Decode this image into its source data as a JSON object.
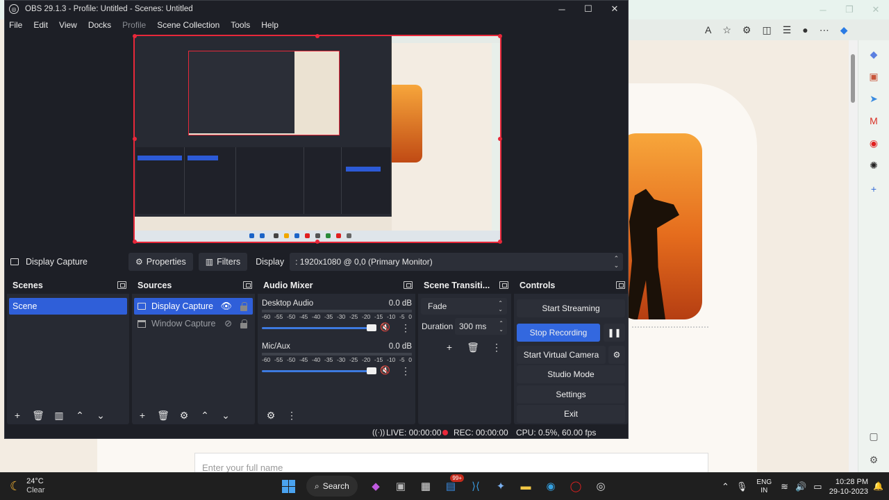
{
  "obs": {
    "title": "OBS 29.1.3 - Profile: Untitled - Scenes: Untitled",
    "window_controls": [
      "─",
      "☐",
      "✕"
    ],
    "menu": [
      {
        "label": "File",
        "disabled": false
      },
      {
        "label": "Edit",
        "disabled": false
      },
      {
        "label": "View",
        "disabled": false
      },
      {
        "label": "Docks",
        "disabled": false
      },
      {
        "label": "Profile",
        "disabled": true
      },
      {
        "label": "Scene Collection",
        "disabled": false
      },
      {
        "label": "Tools",
        "disabled": false
      },
      {
        "label": "Help",
        "disabled": false
      }
    ],
    "source_bar": {
      "source_name": "Display Capture",
      "properties_label": "Properties",
      "filters_label": "Filters",
      "display_label": "Display",
      "display_value": ": 1920x1080 @ 0,0 (Primary Monitor)"
    },
    "docks": {
      "scenes": {
        "title": "Scenes",
        "items": [
          "Scene"
        ]
      },
      "sources": {
        "title": "Sources",
        "items": [
          "Display Capture",
          "Window Capture"
        ]
      },
      "audio_mixer": {
        "title": "Audio Mixer",
        "channels": [
          {
            "name": "Desktop Audio",
            "level": "0.0 dB"
          },
          {
            "name": "Mic/Aux",
            "level": "0.0 dB"
          }
        ],
        "scale": [
          "-60",
          "-55",
          "-50",
          "-45",
          "-40",
          "-35",
          "-30",
          "-25",
          "-20",
          "-15",
          "-10",
          "-5",
          "0"
        ]
      },
      "transitions": {
        "title": "Scene Transiti...",
        "transition": "Fade",
        "duration_label": "Duration",
        "duration_value": "300 ms"
      },
      "controls": {
        "title": "Controls",
        "start_streaming": "Start Streaming",
        "stop_recording": "Stop Recording",
        "start_virtual_camera": "Start Virtual Camera",
        "studio_mode": "Studio Mode",
        "settings": "Settings",
        "exit": "Exit"
      }
    },
    "status": {
      "live": "LIVE: 00:00:00",
      "rec": "REC: 00:00:00",
      "cpu": "CPU: 0.5%, 60.00 fps"
    }
  },
  "browser": {
    "field_placeholder": "Enter your full name"
  },
  "taskbar": {
    "weather_temp": "24°C",
    "weather_desc": "Clear",
    "search_label": "Search",
    "badge": "99+",
    "lang_1": "ENG",
    "lang_2": "IN",
    "time": "10:28 PM",
    "date": "29-10-2023"
  },
  "colors": {
    "accent": "#3368df",
    "selection": "#2f5fd9",
    "recording_red": "#e8283a",
    "obs_bg": "#1d1f26",
    "dock_bg": "#272a33"
  }
}
